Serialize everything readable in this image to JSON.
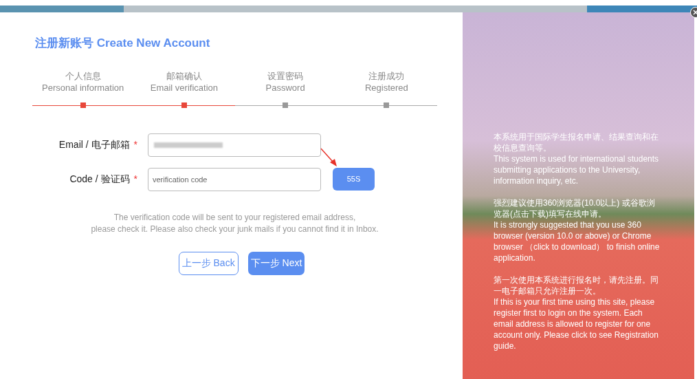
{
  "title": "注册新账号 Create New Account",
  "steps": [
    {
      "zh": "个人信息",
      "en": "Personal information",
      "done": true
    },
    {
      "zh": "邮箱确认",
      "en": "Email verification",
      "done": true
    },
    {
      "zh": "设置密码",
      "en": "Password",
      "done": false
    },
    {
      "zh": "注册成功",
      "en": "Registered",
      "done": false
    }
  ],
  "fields": [
    {
      "label": "Email / 电子邮箱",
      "required": "*",
      "kind": "blurred"
    },
    {
      "label": "Code / 验证码",
      "required": "*",
      "kind": "input",
      "placeholder": "verification code",
      "button": "55S"
    }
  ],
  "note": [
    "The verification code will be sent to your registered email address,",
    "please check it. Please also check your junk mails if you cannot find it in Inbox."
  ],
  "buttons": [
    {
      "label": "上一步 Back",
      "kind": "outline"
    },
    {
      "label": "下一步 Next",
      "kind": "primary"
    }
  ],
  "info": [
    [
      "本系统用于国际学生报名申请、结果查询和在校信息查询等。",
      "This system is used for international students submitting applications to the University, information inquiry, etc."
    ],
    [
      "强烈建议使用360浏览器(10.0以上) 或谷歌浏览器(点击下载)填写在线申请。",
      "It is strongly suggested that you use 360 browser (version 10.0 or above) or Chrome browser （click to download） to finish online application."
    ],
    [
      "第一次使用本系统进行报名时，请先注册。同一电子邮箱只允许注册一次。",
      "If this is your first time using this site, please register first to login on the system. Each email address is allowed to register for one account only. Please click to see Registration guide."
    ]
  ]
}
